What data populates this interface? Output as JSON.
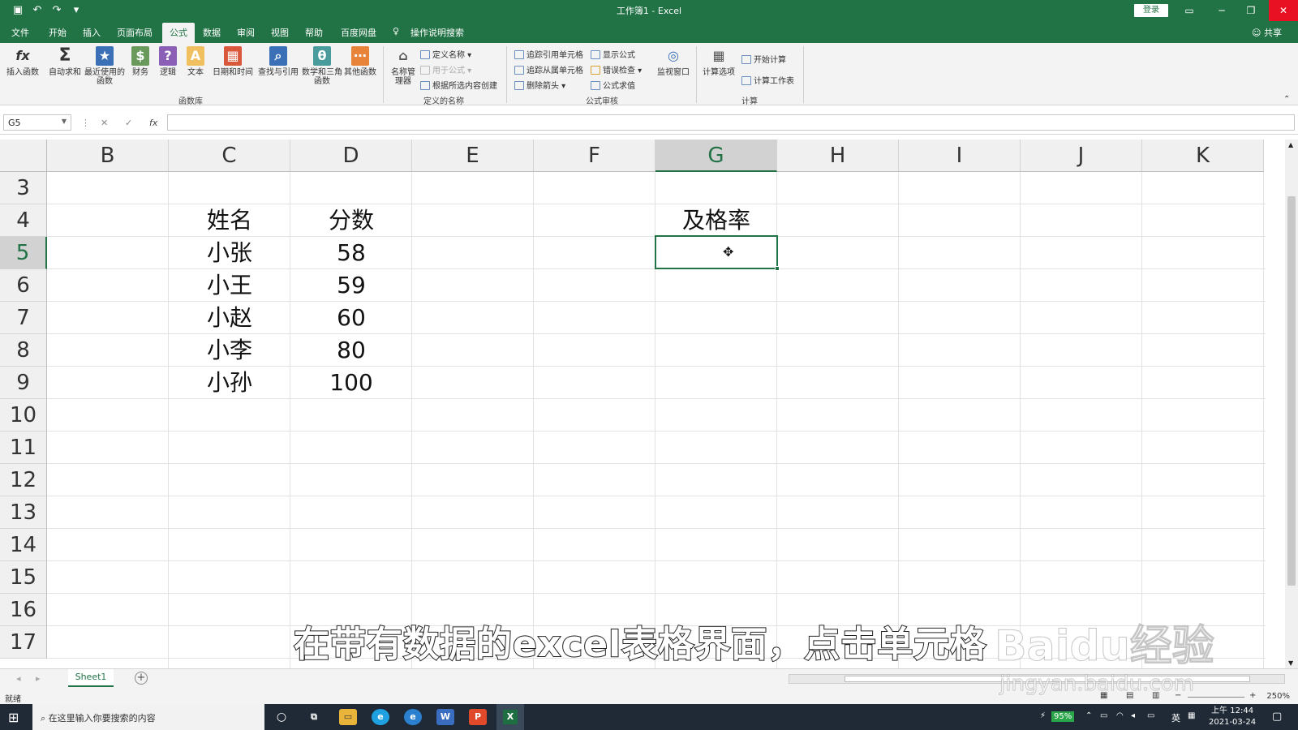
{
  "window": {
    "title": "工作簿1  -  Excel",
    "login": "登录",
    "share": "共享"
  },
  "ribbon_tabs": [
    "文件",
    "开始",
    "插入",
    "页面布局",
    "公式",
    "数据",
    "审阅",
    "视图",
    "帮助",
    "百度网盘"
  ],
  "tell_me": "操作说明搜索",
  "ribbon": {
    "insert_function": "插入函数",
    "autosum": "自动求和",
    "recent": "最近使用的函数",
    "financial": "财务",
    "logical": "逻辑",
    "text": "文本",
    "datetime": "日期和时间",
    "lookup": "查找与引用",
    "math": "数学和三角函数",
    "more": "其他函数",
    "group_library": "函数库",
    "name_manager": "名称管理器",
    "define_name": "定义名称",
    "use_in_formula": "用于公式",
    "create_from_selection": "根据所选内容创建",
    "group_names": "定义的名称",
    "trace_precedents": "追踪引用单元格",
    "trace_dependents": "追踪从属单元格",
    "remove_arrows": "删除箭头",
    "show_formulas": "显示公式",
    "error_checking": "错误检查",
    "evaluate_formula": "公式求值",
    "watch_window": "监视窗口",
    "group_auditing": "公式审核",
    "calc_options": "计算选项",
    "calc_now": "开始计算",
    "calc_sheet": "计算工作表",
    "group_calc": "计算"
  },
  "namebox": "G5",
  "columns": [
    "B",
    "C",
    "D",
    "E",
    "F",
    "G",
    "H",
    "I",
    "J",
    "K"
  ],
  "rows": [
    "3",
    "4",
    "5",
    "6",
    "7",
    "8",
    "9",
    "10",
    "11",
    "12",
    "13",
    "14",
    "15",
    "16",
    "17"
  ],
  "cells": {
    "c4": "姓名",
    "d4": "分数",
    "g4": "及格率",
    "c5": "小张",
    "d5": "58",
    "c6": "小王",
    "d6": "59",
    "c7": "小赵",
    "d7": "60",
    "c8": "小李",
    "d8": "80",
    "c9": "小孙",
    "d9": "100"
  },
  "sheet_tab": "Sheet1",
  "status": "就绪",
  "zoom": "250%",
  "subtitle": "在带有数据的excel表格界面，点击单元格",
  "watermark": {
    "brand": "Baidu经验",
    "url": "jingyan.baidu.com"
  },
  "taskbar": {
    "search_placeholder": "在这里输入你要搜索的内容",
    "battery": "95%",
    "ime": "英",
    "time": "上午 12:44",
    "date": "2021-03-24"
  },
  "colors": {
    "accent": "#217346",
    "close": "#e81123"
  }
}
